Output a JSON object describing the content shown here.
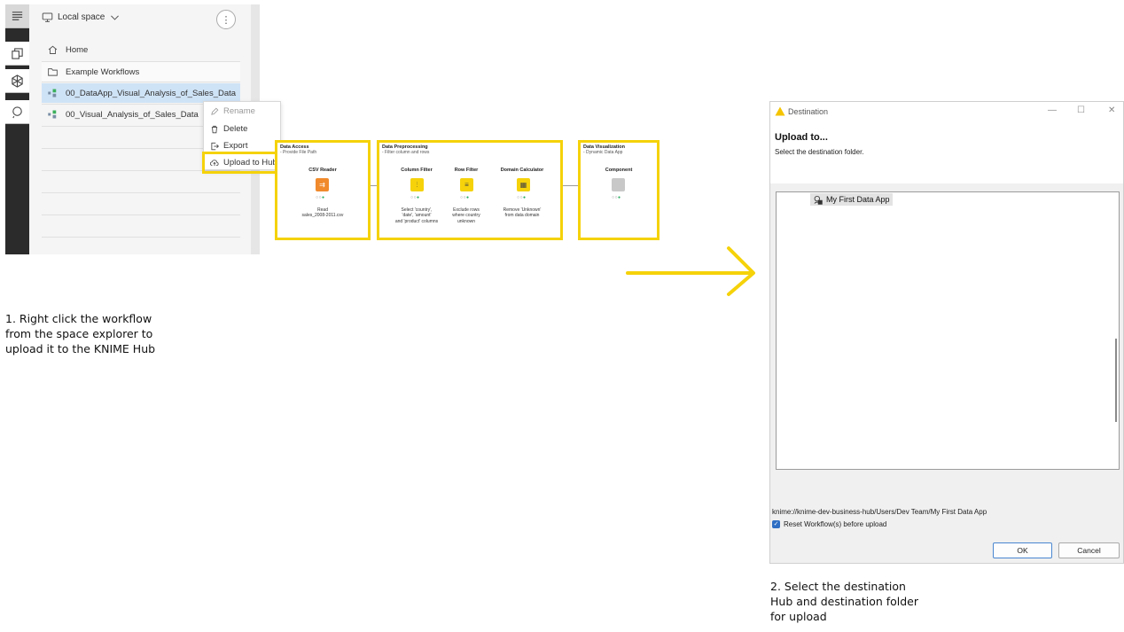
{
  "explorer": {
    "space_label": "Local space",
    "home_label": "Home",
    "items": [
      {
        "label": "Example Workflows",
        "icon": "folder-icon"
      },
      {
        "label": "00_DataApp_Visual_Analysis_of_Sales_Data",
        "icon": "workflow-icon",
        "selected": true
      },
      {
        "label": "00_Visual_Analysis_of_Sales_Data",
        "icon": "workflow-icon"
      }
    ],
    "context_menu": {
      "rename": "Rename",
      "delete": "Delete",
      "export": "Export",
      "upload": "Upload to Hub"
    }
  },
  "workflow": {
    "annotations": [
      {
        "title": "Data Access",
        "subtitle": "- Provide File Path"
      },
      {
        "title": "Data Preprocessing",
        "subtitle": "- Filter column and rows"
      },
      {
        "title": "Data Visualization",
        "subtitle": "- Dynamic Data App"
      }
    ],
    "nodes": [
      {
        "name": "CSV Reader",
        "desc": "Read\nsales_2008-2011.csv",
        "color": "#f08a2c"
      },
      {
        "name": "Column Filter",
        "desc": "Select 'country',\n'date', 'amount'\nand 'product' columns",
        "color": "#f5d20a"
      },
      {
        "name": "Row Filter",
        "desc": "Exclude rows\nwhere country\nunknown",
        "color": "#f5d20a"
      },
      {
        "name": "Domain Calculator",
        "desc": "Remove 'Unknown'\nfrom data domain",
        "color": "#f5d20a"
      },
      {
        "name": "Component",
        "desc": "",
        "color": "#c8c8c8"
      }
    ]
  },
  "dialog": {
    "title": "Destination",
    "heading": "Upload to...",
    "subheading": "Select the destination folder.",
    "tree_item": "My First Data App",
    "path": "knime://knime-dev-business-hub/Users/Dev Team/My First Data App",
    "checkbox_label": "Reset Workflow(s) before upload",
    "ok_label": "OK",
    "cancel_label": "Cancel"
  },
  "captions": {
    "step1": "1. Right click the workflow\nfrom the space explorer to\nupload it to the KNIME Hub",
    "step2": "2. Select the destination\nHub and destination folder\nfor upload"
  },
  "colors": {
    "highlight": "#f5d20a",
    "selection": "#cfe3f6",
    "primary": "#2f6fc4"
  }
}
